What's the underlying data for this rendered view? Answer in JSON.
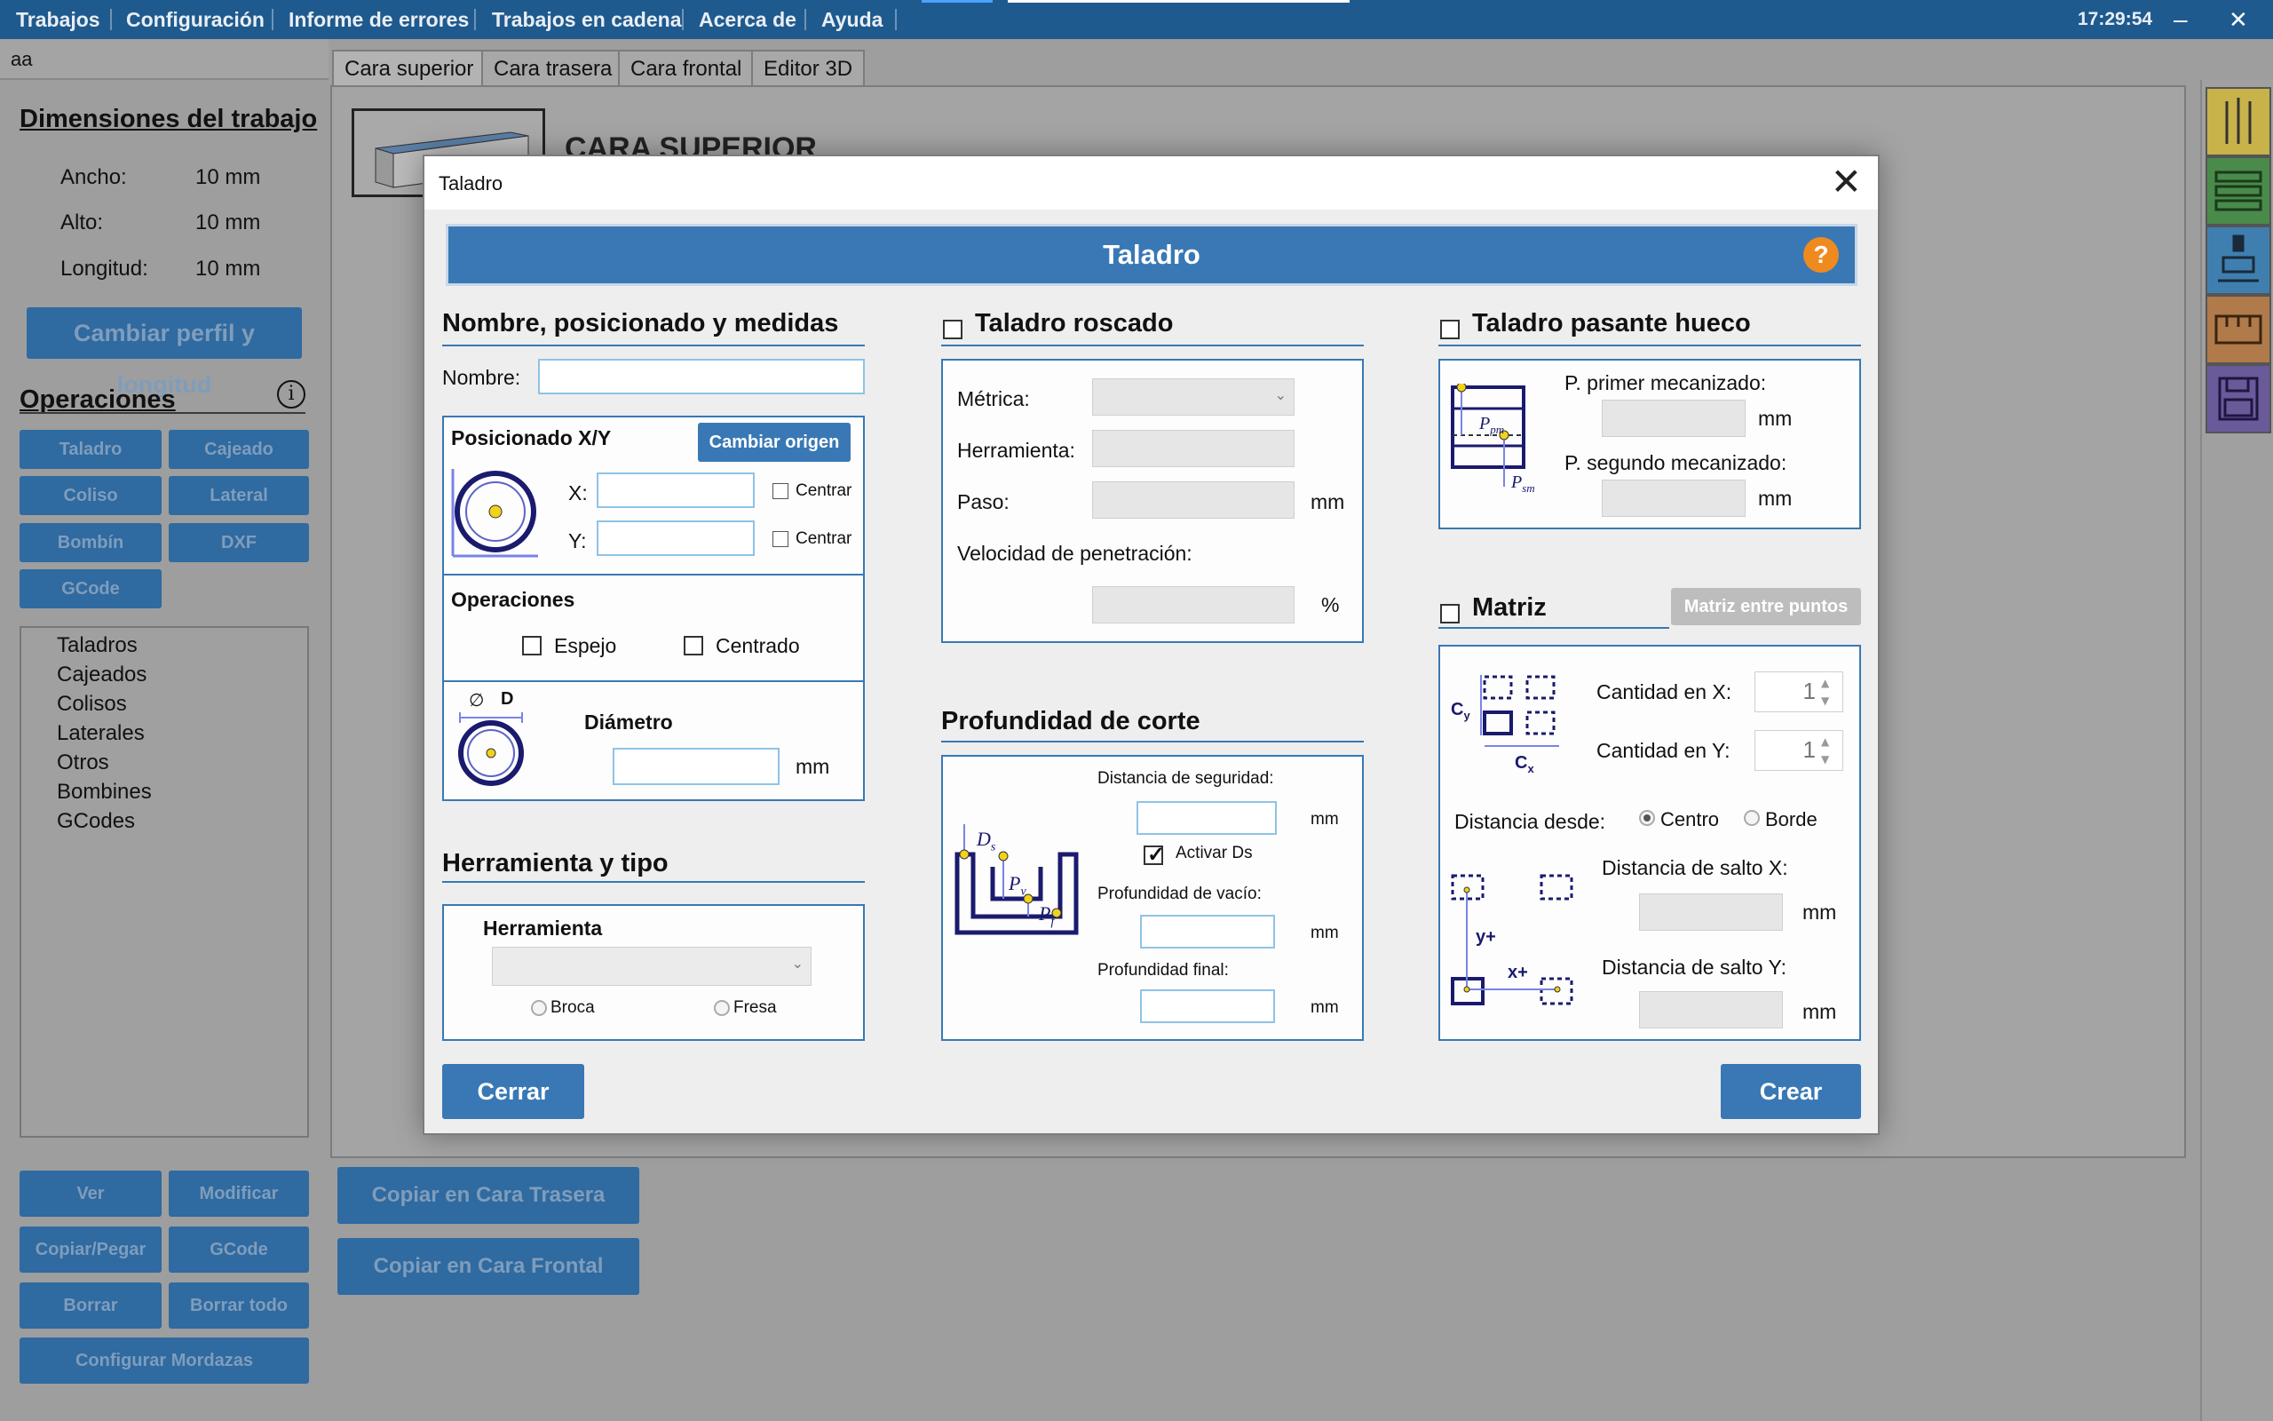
{
  "menubar": {
    "items": [
      "Trabajos",
      "Configuración",
      "Informe de errores",
      "Trabajos en cadena",
      "Acerca de",
      "Ayuda"
    ],
    "clock": "17:29:54",
    "minimize": "–",
    "close": "✕"
  },
  "left": {
    "top_text": "aa",
    "dims_title": "Dimensiones del trabajo",
    "dims": [
      {
        "label": "Ancho:",
        "value": "10 mm"
      },
      {
        "label": "Alto:",
        "value": "10 mm"
      },
      {
        "label": "Longitud:",
        "value": "10 mm"
      }
    ],
    "change_profile": "Cambiar perfil y longitud",
    "ops_title": "Operaciones",
    "info_icon": "i",
    "op_buttons": [
      "Taladro",
      "Cajeado",
      "Coliso",
      "Lateral",
      "Bombín",
      "DXF",
      "GCode"
    ],
    "list": [
      "Taladros",
      "Cajeados",
      "Colisos",
      "Laterales",
      "Otros",
      "Bombines",
      "GCodes"
    ],
    "bottom_buttons": [
      "Ver",
      "Modificar",
      "Copiar/Pegar",
      "GCode",
      "Borrar",
      "Borrar todo"
    ],
    "mordazas": "Configurar Mordazas"
  },
  "tabs": [
    "Cara superior",
    "Cara trasera",
    "Cara frontal",
    "Editor 3D"
  ],
  "workarea": {
    "face_title": "CARA SUPERIOR",
    "copy_back": "Copiar en Cara Trasera",
    "copy_front": "Copiar en Cara Frontal"
  },
  "dialog": {
    "title": "Taladro",
    "banner": "Taladro",
    "help": "?",
    "sec1": {
      "title": "Nombre, posicionado y medidas",
      "name_label": "Nombre:",
      "name_value": "",
      "pos_title": "Posicionado X/Y",
      "change_origin": "Cambiar origen",
      "x_label": "X:",
      "y_label": "Y:",
      "x_value": "",
      "y_value": "",
      "center_label": "Centrar",
      "ops_title": "Operaciones",
      "mirror": "Espejo",
      "centered": "Centrado",
      "diam_symbol": "∅",
      "diam_letter": "D",
      "diameter": "Diámetro",
      "diam_value": "",
      "mm": "mm"
    },
    "sec_tool": {
      "title": "Herramienta y tipo",
      "tool_label": "Herramienta",
      "tool_value": "",
      "broca": "Broca",
      "fresa": "Fresa"
    },
    "sec_thread": {
      "title": "Taladro roscado",
      "metric": "Métrica:",
      "tool": "Herramienta:",
      "pitch": "Paso:",
      "speed": "Velocidad de penetración:",
      "mm": "mm",
      "percent": "%"
    },
    "sec_depth": {
      "title": "Profundidad de corte",
      "safety": "Distancia de seguridad:",
      "safety_value": "",
      "activate_ds": "Activar Ds",
      "activate_ds_checked": true,
      "vacuum": "Profundidad de vacío:",
      "vacuum_value": "",
      "final": "Profundidad final:",
      "final_value": "",
      "mm": "mm",
      "ds": "D",
      "ds_sub": "s",
      "pv": "P",
      "pv_sub": "v",
      "pf": "P",
      "pf_sub": "f"
    },
    "sec_through": {
      "title": "Taladro pasante hueco",
      "first": "P. primer mecanizado:",
      "second": "P. segundo mecanizado:",
      "mm": "mm",
      "ppm": "P",
      "ppm_sub": "pm",
      "psm": "P",
      "psm_sub": "sm"
    },
    "sec_matrix": {
      "title": "Matriz",
      "between": "Matriz entre puntos",
      "qty_x": "Cantidad en X:",
      "qty_y": "Cantidad en Y:",
      "qty_x_value": "1",
      "qty_y_value": "1",
      "dist_from": "Distancia desde:",
      "center": "Centro",
      "border": "Borde",
      "jump_x": "Distancia de salto X:",
      "jump_y": "Distancia de salto Y:",
      "mm": "mm",
      "cx": "C",
      "cx_sub": "x",
      "cy": "C",
      "cy_sub": "y",
      "yplus": "y+",
      "xplus": "x+"
    },
    "close_btn": "Cerrar",
    "create_btn": "Crear"
  }
}
